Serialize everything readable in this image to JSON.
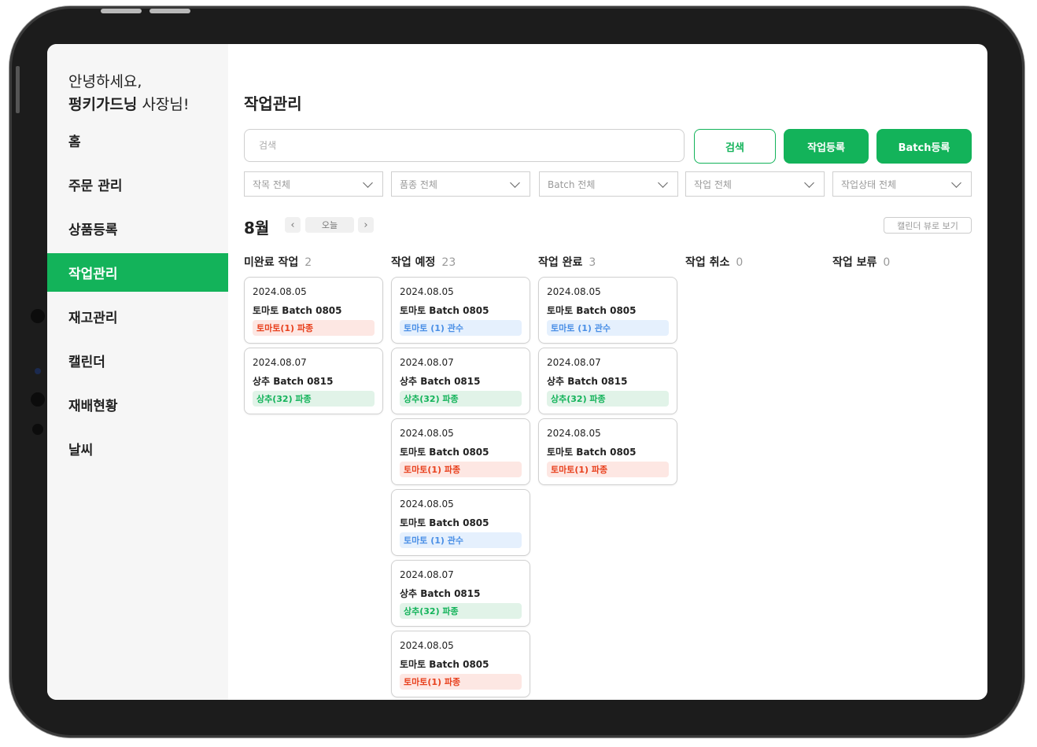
{
  "sidebar": {
    "greeting_line1": "안녕하세요,",
    "greeting_name": "펑키가드닝",
    "greeting_suffix": " 사장님!",
    "items": [
      {
        "label": "홈"
      },
      {
        "label": "주문 관리"
      },
      {
        "label": "상품등록"
      },
      {
        "label": "작업관리"
      },
      {
        "label": "재고관리"
      },
      {
        "label": "캘린더"
      },
      {
        "label": "재배현황"
      },
      {
        "label": "날씨"
      }
    ],
    "active_index": 3
  },
  "main": {
    "title": "작업관리",
    "search_placeholder": "검색",
    "search_button": "검색",
    "add_task_button": "작업등록",
    "add_batch_button": "Batch등록",
    "filters": [
      "작목 전체",
      "품종 전체",
      "Batch 전체",
      "작업 전체",
      "작업상태 전체"
    ],
    "month": "8월",
    "prev": "‹",
    "next": "›",
    "today": "오늘",
    "calendar_view": "캘린더 뷰로 보기"
  },
  "colors": {
    "accent": "#13b35a",
    "tag_red": "#e8411e",
    "tag_blue": "#4a8fe6",
    "tag_green": "#13b35a"
  },
  "columns": [
    {
      "title": "미완료 작업",
      "count": "2",
      "cards": [
        {
          "date": "2024.08.05",
          "name": "토마토 Batch 0805",
          "tag": "토마토(1) 파종",
          "tone": "red"
        },
        {
          "date": "2024.08.07",
          "name": "상추 Batch 0815",
          "tag": "상추(32) 파종",
          "tone": "green"
        }
      ]
    },
    {
      "title": "작업 예정",
      "count": "23",
      "cards": [
        {
          "date": "2024.08.05",
          "name": "토마토 Batch 0805",
          "tag": "토마토 (1) 관수",
          "tone": "blue"
        },
        {
          "date": "2024.08.07",
          "name": "상추 Batch 0815",
          "tag": "상추(32) 파종",
          "tone": "green"
        },
        {
          "date": "2024.08.05",
          "name": "토마토 Batch 0805",
          "tag": "토마토(1) 파종",
          "tone": "red"
        },
        {
          "date": "2024.08.05",
          "name": "토마토 Batch 0805",
          "tag": "토마토 (1) 관수",
          "tone": "blue"
        },
        {
          "date": "2024.08.07",
          "name": "상추 Batch 0815",
          "tag": "상추(32) 파종",
          "tone": "green"
        },
        {
          "date": "2024.08.05",
          "name": "토마토 Batch 0805",
          "tag": "토마토(1) 파종",
          "tone": "red"
        }
      ]
    },
    {
      "title": "작업 완료",
      "count": "3",
      "cards": [
        {
          "date": "2024.08.05",
          "name": "토마토 Batch 0805",
          "tag": "토마토 (1) 관수",
          "tone": "blue"
        },
        {
          "date": "2024.08.07",
          "name": "상추 Batch 0815",
          "tag": "상추(32) 파종",
          "tone": "green"
        },
        {
          "date": "2024.08.05",
          "name": "토마토 Batch 0805",
          "tag": "토마토(1) 파종",
          "tone": "red"
        }
      ]
    },
    {
      "title": "작업 취소",
      "count": "0",
      "cards": []
    },
    {
      "title": "작업 보류",
      "count": "0",
      "cards": []
    }
  ]
}
